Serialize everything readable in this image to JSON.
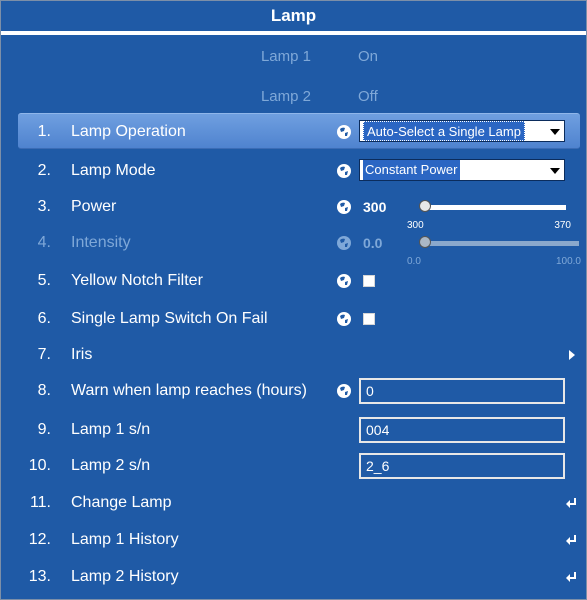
{
  "title": "Lamp",
  "status": [
    {
      "label": "Lamp 1",
      "value": "On"
    },
    {
      "label": "Lamp 2",
      "value": "Off"
    }
  ],
  "rows": [
    {
      "num": "1.",
      "label": "Lamp Operation",
      "control": "dropdown",
      "value": "Auto-Select a Single Lamp"
    },
    {
      "num": "2.",
      "label": "Lamp Mode",
      "control": "dropdown",
      "value": "Constant Power"
    },
    {
      "num": "3.",
      "label": "Power",
      "control": "slider",
      "value": "300",
      "min": "300",
      "max": "370",
      "level": 0.0
    },
    {
      "num": "4.",
      "label": "Intensity",
      "control": "slider",
      "value": "0.0",
      "min": "0.0",
      "max": "100.0",
      "level": 0.0,
      "disabled": true
    },
    {
      "num": "5.",
      "label": "Yellow Notch Filter",
      "control": "checkbox",
      "checked": false
    },
    {
      "num": "6.",
      "label": "Single Lamp Switch On Fail",
      "control": "checkbox",
      "checked": false
    },
    {
      "num": "7.",
      "label": "Iris",
      "control": "submenu"
    },
    {
      "num": "8.",
      "label": "Warn when lamp reaches (hours)",
      "control": "input",
      "value": "0"
    },
    {
      "num": "9.",
      "label": "Lamp 1 s/n",
      "control": "input",
      "value": "004"
    },
    {
      "num": "10.",
      "label": "Lamp 2 s/n",
      "control": "input",
      "value": "2_6"
    },
    {
      "num": "11.",
      "label": "Change Lamp",
      "control": "action"
    },
    {
      "num": "12.",
      "label": "Lamp 1 History",
      "control": "action"
    },
    {
      "num": "13.",
      "label": "Lamp 2 History",
      "control": "action"
    }
  ],
  "colors": {
    "background": "#1f5aa6",
    "selected": "#5b8fd8",
    "disabled_text": "#7fa8d8"
  },
  "icons": {
    "globe": "globe-icon",
    "submenu": "arrow-right-icon",
    "action": "enter-icon"
  }
}
